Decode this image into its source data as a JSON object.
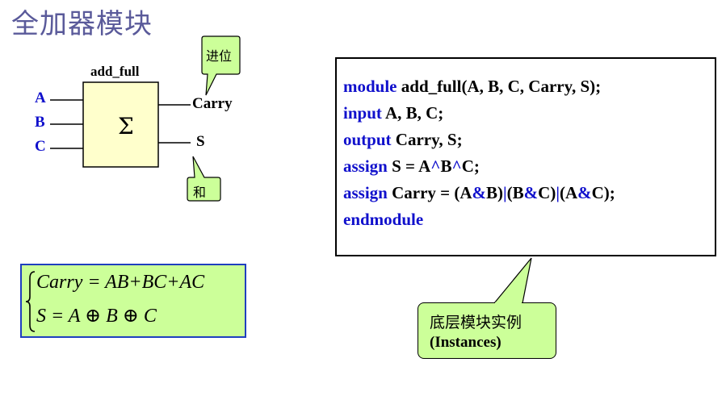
{
  "title": "全加器模块",
  "diagram": {
    "module_label": "add_full",
    "symbol": "Σ",
    "inputs": [
      "A",
      "B",
      "C"
    ],
    "outputs": {
      "carry": "Carry",
      "sum": "S"
    },
    "callout_carry": "进位",
    "callout_sum": "和"
  },
  "code": {
    "line1": {
      "kw": "module",
      "rest": " add_full(A, B, C, Carry, S);"
    },
    "line2": {
      "kw": "input",
      "rest": " A, B, C;"
    },
    "line3": {
      "kw": "output",
      "rest": " Carry, S;"
    },
    "line4": {
      "kw": "assign",
      "pre": " S = A",
      "op1": "^",
      "mid": "B",
      "op2": "^",
      "post": "C;"
    },
    "line5": {
      "kw": "assign",
      "pre": " Carry = (A",
      "amp1": "&",
      "b1": "B)",
      "or1": "|",
      "p2": "(B",
      "amp2": "&",
      "c2": "C)",
      "or2": "|",
      "p3": "(A",
      "amp3": "&",
      "c3": "C);"
    },
    "line6": {
      "kw": "endmodule"
    }
  },
  "equations": {
    "carry": "Carry = AB+BC+AC",
    "sum": "S = A  ⊕ B  ⊕ C"
  },
  "instances_callout": {
    "cn": "底层模块实例",
    "en": "(Instances)"
  },
  "colors": {
    "title": "#5a5a9a",
    "keyword": "#1010cc",
    "block_fill": "#ffffcc",
    "callout_fill": "#ccff99",
    "equation_border": "#1f3fbf"
  }
}
